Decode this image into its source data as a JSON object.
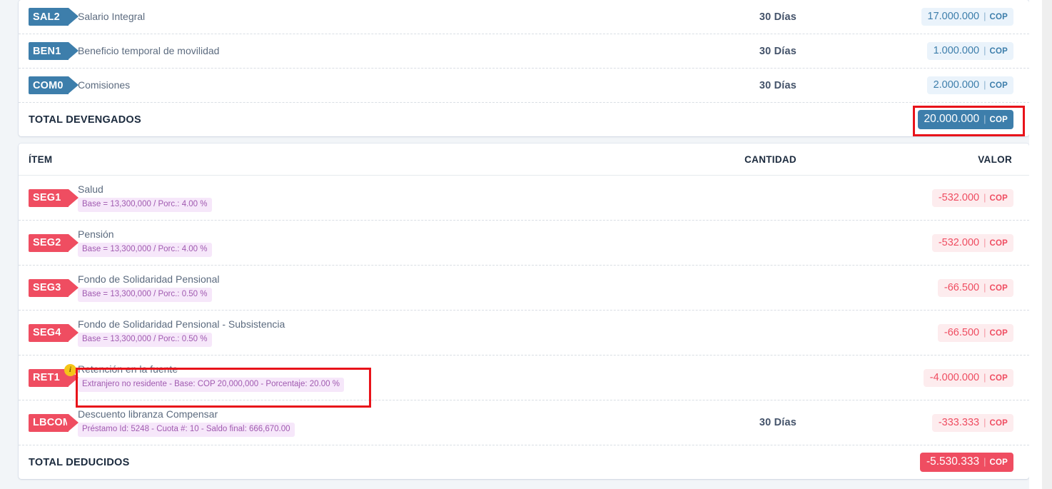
{
  "currency": "COP",
  "colors": {
    "earning_accent": "#3d7eab",
    "deduction_accent": "#ef4d61",
    "highlight_box": "#e8131a",
    "info_badge": "#f5c518",
    "subchip_bg": "#f6e7fa",
    "subchip_text": "#a05ab0",
    "page_bg": "#f2f5f8"
  },
  "earnings_card": {
    "rows": [
      {
        "code": "SAL2",
        "name": "Salario Integral",
        "sub": "",
        "quantity": "30 Días",
        "value": "17.000.000",
        "currency": "COP"
      },
      {
        "code": "BEN1",
        "name": "Beneficio temporal de movilidad",
        "sub": "",
        "quantity": "30 Días",
        "value": "1.000.000",
        "currency": "COP"
      },
      {
        "code": "COM0",
        "name": "Comisiones",
        "sub": "",
        "quantity": "30 Días",
        "value": "2.000.000",
        "currency": "COP"
      }
    ],
    "total": {
      "label": "TOTAL DEVENGADOS",
      "value": "20.000.000",
      "currency": "COP",
      "highlighted": true
    }
  },
  "deductions_card": {
    "headers": {
      "item": "ÍTEM",
      "quantity": "CANTIDAD",
      "value": "VALOR"
    },
    "rows": [
      {
        "code": "SEG1",
        "name": "Salud",
        "sub": "Base = 13,300,000 / Porc.: 4.00 %",
        "quantity": "",
        "value": "-532.000",
        "currency": "COP",
        "badge": ""
      },
      {
        "code": "SEG2",
        "name": "Pensión",
        "sub": "Base = 13,300,000 / Porc.: 4.00 %",
        "quantity": "",
        "value": "-532.000",
        "currency": "COP",
        "badge": ""
      },
      {
        "code": "SEG3",
        "name": "Fondo de Solidaridad Pensional",
        "sub": "Base = 13,300,000 / Porc.: 0.50 %",
        "quantity": "",
        "value": "-66.500",
        "currency": "COP",
        "badge": ""
      },
      {
        "code": "SEG4",
        "name": "Fondo de Solidaridad Pensional - Subsistencia",
        "sub": "Base = 13,300,000 / Porc.: 0.50 %",
        "quantity": "",
        "value": "-66.500",
        "currency": "COP",
        "badge": ""
      },
      {
        "code": "RET1",
        "name": "Retención en la fuente",
        "sub": "Extranjero no residente - Base: COP 20,000,000 - Porcentaje: 20.00 %",
        "quantity": "",
        "value": "-4.000.000",
        "currency": "COP",
        "badge": "i"
      },
      {
        "code": "LBCOM",
        "name": "Descuento libranza Compensar",
        "sub": "Préstamo Id: 5248 - Cuota #: 10 - Saldo final: 666,670.00",
        "quantity": "30 Días",
        "value": "-333.333",
        "currency": "COP",
        "badge": ""
      }
    ],
    "total": {
      "label": "TOTAL DEDUCIDOS",
      "value": "-5.530.333",
      "currency": "COP",
      "highlighted": false
    }
  },
  "separator": "|"
}
